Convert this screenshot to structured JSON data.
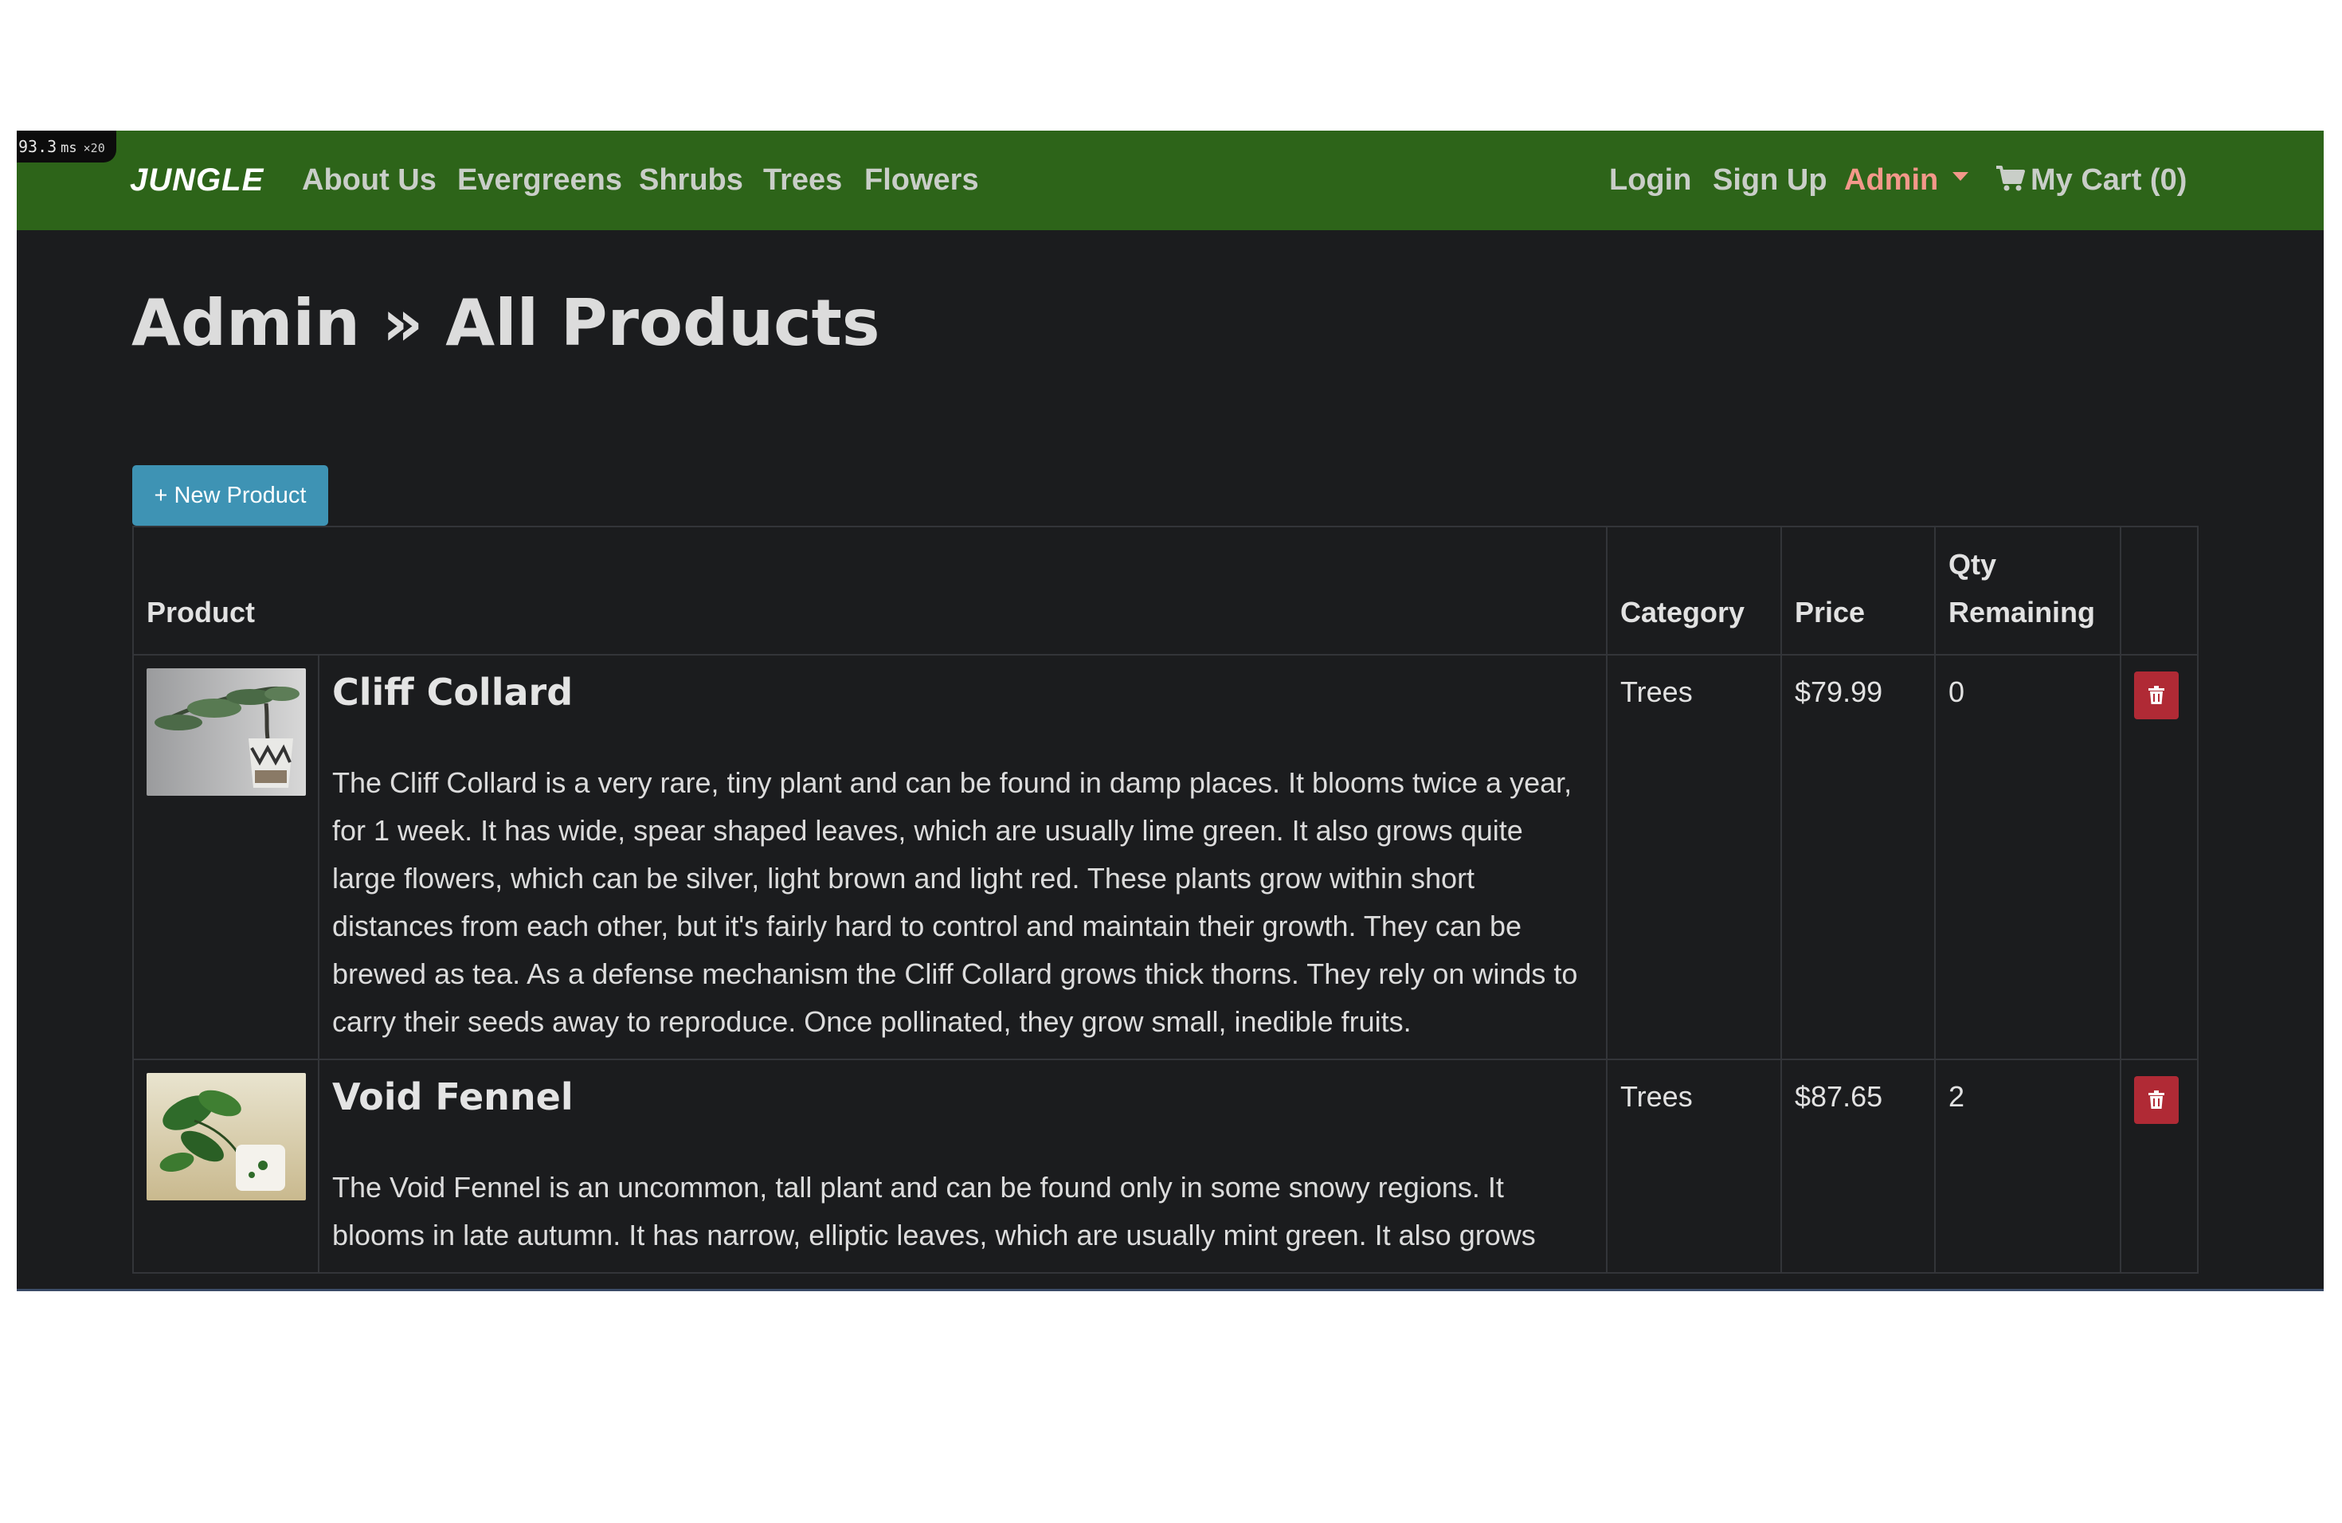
{
  "debug": {
    "time": "93.3",
    "unit": "ms",
    "multiplier": "×20"
  },
  "navbar": {
    "brand": "JUNGLE",
    "links": [
      "About Us",
      "Evergreens",
      "Shrubs",
      "Trees",
      "Flowers"
    ],
    "login": "Login",
    "signup": "Sign Up",
    "admin": "Admin",
    "cart": "My Cart (0)",
    "admin_color": "#f3988a",
    "bar_color": "#2d6419"
  },
  "page": {
    "title": "Admin » All Products",
    "new_product_label": "+ New Product",
    "button_color": "#3e93b4",
    "delete_color": "#b02a35"
  },
  "table": {
    "headers": {
      "product": "Product",
      "category": "Category",
      "price": "Price",
      "qty": "Qty Remaining"
    },
    "rows": [
      {
        "image": "bonsai-tree-image",
        "name": "Cliff Collard",
        "description": "The Cliff Collard is a very rare, tiny plant and can be found in damp places. It blooms twice a year, for 1 week. It has wide, spear shaped leaves, which are usually lime green. It also grows quite large flowers, which can be silver, light brown and light red. These plants grow within short distances from each other, but it's fairly hard to control and maintain their growth. They can be brewed as tea. As a defense mechanism the Cliff Collard grows thick thorns. They rely on winds to carry their seeds away to reproduce. Once pollinated, they grow small, inedible fruits.",
        "category": "Trees",
        "price": "$79.99",
        "qty": "0"
      },
      {
        "image": "potted-plant-image",
        "name": "Void Fennel",
        "description": "The Void Fennel is an uncommon, tall plant and can be found only in some snowy regions. It blooms in late autumn. It has narrow, elliptic leaves, which are usually mint green. It also grows",
        "category": "Trees",
        "price": "$87.65",
        "qty": "2"
      }
    ]
  }
}
